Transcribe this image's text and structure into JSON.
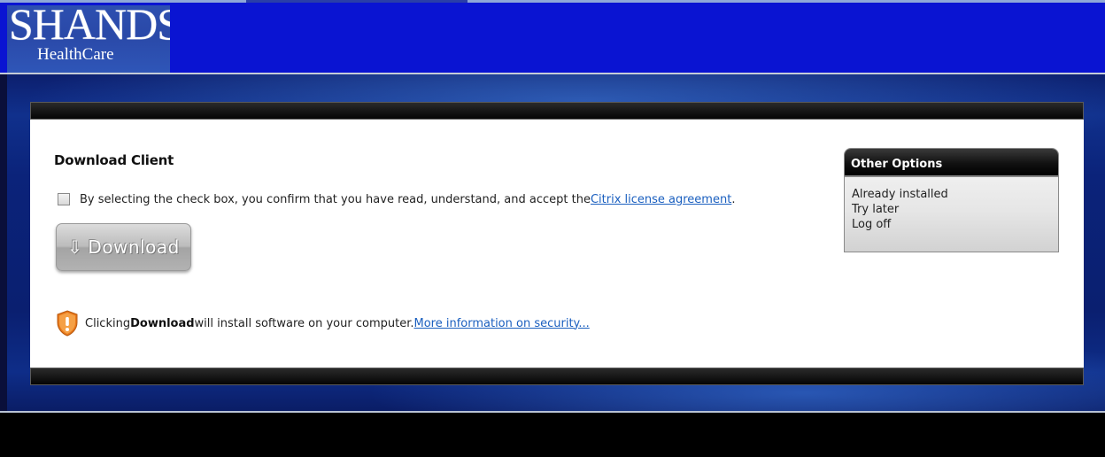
{
  "logo": {
    "main": "SHANDS",
    "sub": "HealthCare"
  },
  "download_client": {
    "title": "Download Client",
    "agreement": {
      "text_before": "By selecting the check box, you confirm that you have read, understand, and accept the ",
      "link": "Citrix license agreement",
      "text_after": "."
    },
    "button_label": "Download",
    "security": {
      "text_before": "Clicking ",
      "bold": "Download",
      "text_after": " will install software on your computer. ",
      "link": "More information on security..."
    }
  },
  "other_options": {
    "title": "Other Options",
    "items": [
      {
        "label": "Already installed"
      },
      {
        "label": "Try later"
      },
      {
        "label": "Log off"
      }
    ]
  },
  "colors": {
    "header_blue": "#0a14d2",
    "link_blue": "#1a5fbf",
    "shield_orange": "#f08a1e"
  },
  "icons": {
    "download_arrow": "download-arrow-icon",
    "security": "shield-warning-icon"
  }
}
